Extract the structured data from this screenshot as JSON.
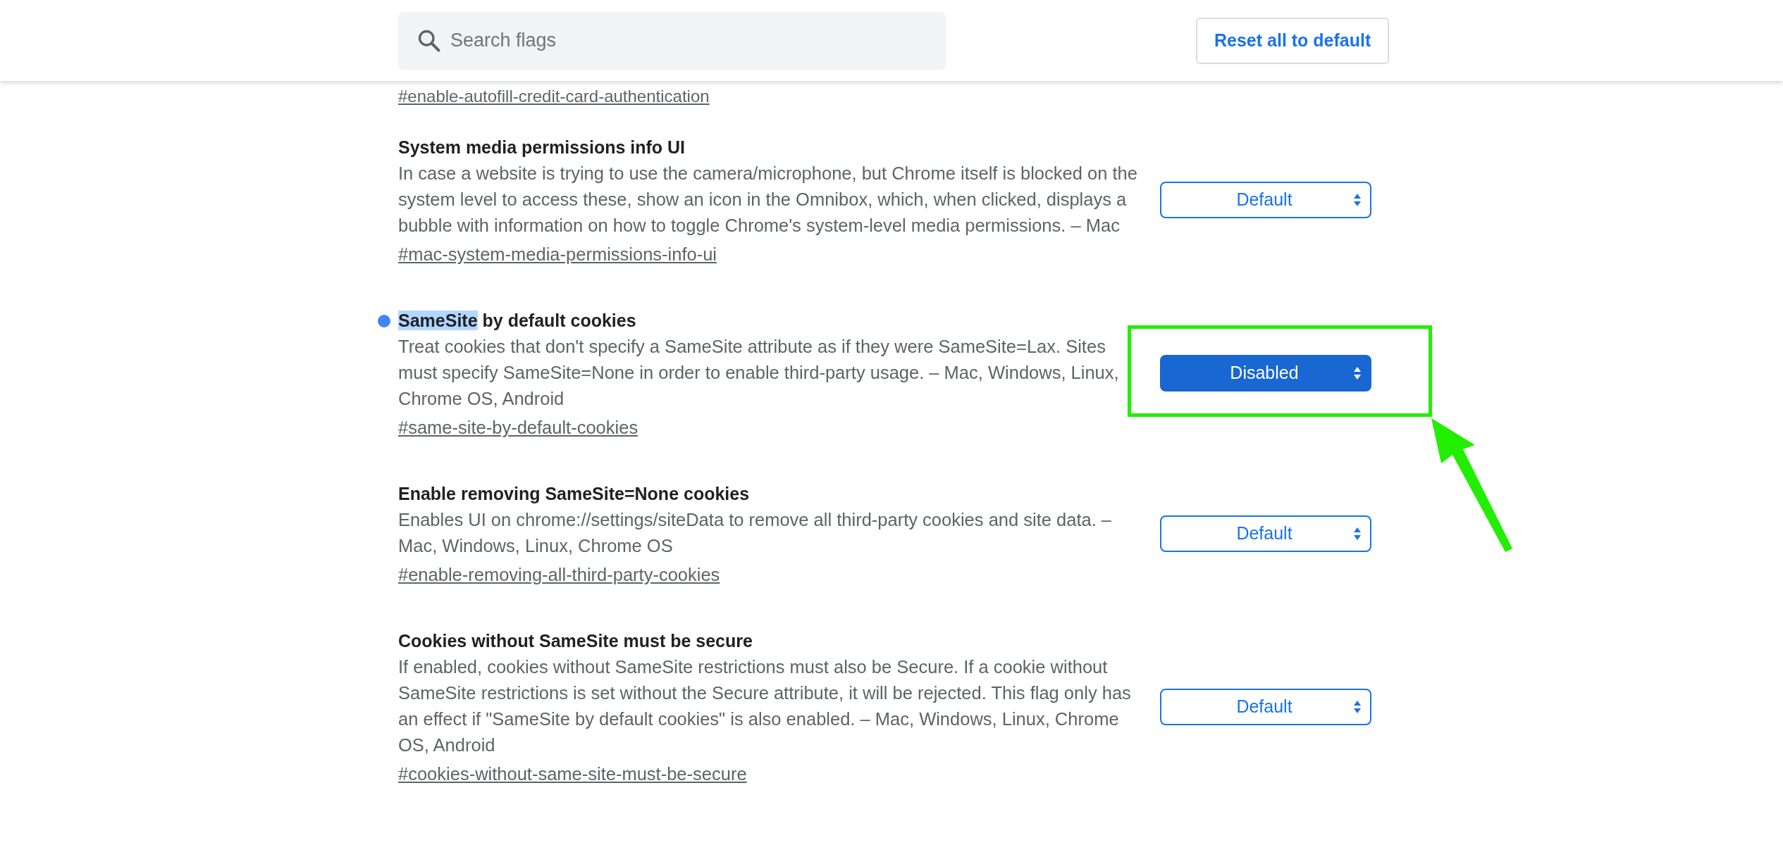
{
  "header": {
    "search": {
      "placeholder": "Search flags"
    },
    "reset_button": "Reset all to default"
  },
  "partial_link": "#enable-autofill-credit-card-authentication",
  "flags": [
    {
      "title": [
        {
          "text": "System media permissions info UI",
          "highlighted": false
        }
      ],
      "modified": false,
      "annotated": false,
      "description": "In case a website is trying to use the camera/microphone, but Chrome itself is blocked on the system level to access these, show an icon in the Omnibox, which, when clicked, displays a bubble with information on how to toggle Chrome's system-level media permissions. – Mac",
      "link": "#mac-system-media-permissions-info-ui",
      "value": "Default"
    },
    {
      "title": [
        {
          "text": "SameSite",
          "highlighted": true
        },
        {
          "text": " by default cookies",
          "highlighted": false
        }
      ],
      "modified": true,
      "annotated": true,
      "description": "Treat cookies that don't specify a SameSite attribute as if they were SameSite=Lax. Sites must specify SameSite=None in order to enable third-party usage. – Mac, Windows, Linux, Chrome OS, Android",
      "link": "#same-site-by-default-cookies",
      "value": "Disabled"
    },
    {
      "title": [
        {
          "text": "Enable removing SameSite=None cookies",
          "highlighted": false
        }
      ],
      "modified": false,
      "annotated": false,
      "description": "Enables UI on chrome://settings/siteData to remove all third-party cookies and site data. – Mac, Windows, Linux, Chrome OS",
      "link": "#enable-removing-all-third-party-cookies",
      "value": "Default"
    },
    {
      "title": [
        {
          "text": "Cookies without SameSite must be secure",
          "highlighted": false
        }
      ],
      "modified": false,
      "annotated": false,
      "description": "If enabled, cookies without SameSite restrictions must also be Secure. If a cookie without SameSite restrictions is set without the Secure attribute, it will be rejected. This flag only has an effect if \"SameSite by default cookies\" is also enabled. – Mac, Windows, Linux, Chrome OS, Android",
      "link": "#cookies-without-same-site-must-be-secure",
      "value": "Default"
    }
  ]
}
